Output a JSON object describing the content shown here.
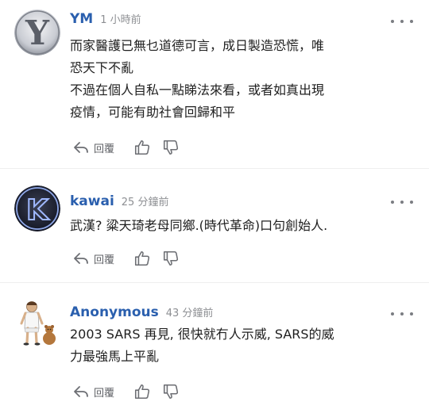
{
  "comments": [
    {
      "author": "YM",
      "time": "1 小時前",
      "avatar_letter": "Y",
      "lines": [
        "而家醫護已無乜道德可言，成日製造恐慌，唯",
        "恐天下不亂",
        "不過在個人自私一點睇法來看，或者如真出現",
        "疫情，可能有助社會回歸和平"
      ],
      "reply_label": "回覆"
    },
    {
      "author": "kawai",
      "time": "25 分鐘前",
      "avatar_letter": "K",
      "lines": [
        "武漢? 粱天琦老母同鄉.(時代革命)口句創始人."
      ],
      "reply_label": "回覆"
    },
    {
      "author": "Anonymous",
      "time": "43 分鐘前",
      "lines": [
        "2003 SARS 再見, 很快就冇人示威, SARS的威",
        "力最強馬上平亂"
      ],
      "reply_label": "回覆"
    }
  ],
  "colors": {
    "author": "#2a5fae",
    "meta": "#8d8f93",
    "text": "#1f1f1f",
    "icon": "#6c6e73"
  },
  "icons": {
    "reply": "reply-arrow-icon",
    "like": "thumbs-up-icon",
    "dislike": "thumbs-down-icon",
    "more": "more-options-icon"
  }
}
